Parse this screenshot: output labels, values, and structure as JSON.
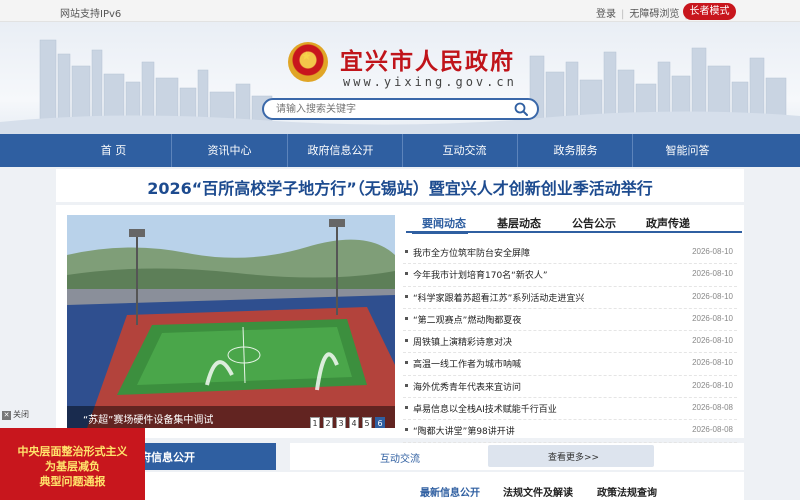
{
  "topbar": {
    "ipv6": "网站支持IPv6",
    "login": "登录",
    "accessible": "无障碍浏览",
    "elder_mode": "长者模式"
  },
  "header": {
    "title": "宜兴市人民政府",
    "url": "www.yixing.gov.cn",
    "emblem_icon": "national-emblem-icon"
  },
  "search": {
    "placeholder": "请输入搜索关键字",
    "icon": "search-icon"
  },
  "nav": {
    "items": [
      "首 页",
      "资讯中心",
      "政府信息公开",
      "互动交流",
      "政务服务",
      "智能问答"
    ]
  },
  "headline": "2026“百所高校学子地方行”（无锡站）暨宜兴人才创新创业季活动举行",
  "slideshow": {
    "caption": "“苏超”赛场硬件设备集中调试",
    "pages": [
      "1",
      "2",
      "3",
      "4",
      "5",
      "6"
    ],
    "active_page": 6
  },
  "news_tabs": [
    "要闻动态",
    "基层动态",
    "公告公示",
    "政声传递"
  ],
  "news": [
    {
      "title": "我市全方位筑牢防台安全屏障",
      "date": "2026-08-10"
    },
    {
      "title": "今年我市计划培育170名“新农人”",
      "date": "2026-08-10"
    },
    {
      "title": "“科学家跟着苏超看江苏”系列活动走进宜兴",
      "date": "2026-08-10"
    },
    {
      "title": "“第二观赛点”燃动陶都夏夜",
      "date": "2026-08-10"
    },
    {
      "title": "周铁镇上演精彩诗意对决",
      "date": "2026-08-10"
    },
    {
      "title": "高温一线工作者为城市呐喊",
      "date": "2026-08-10"
    },
    {
      "title": "海外优秀青年代表来宜访问",
      "date": "2026-08-10"
    },
    {
      "title": "卓易信息以全栈AI技术赋能千行百业",
      "date": "2026-08-08"
    },
    {
      "title": "“陶都大讲堂”第98讲开讲",
      "date": "2026-08-08"
    }
  ],
  "lower": {
    "tab1": "府信息公开",
    "tab2": "互动交流",
    "more": "查看更多>>",
    "subtabs": [
      "最新信息公开",
      "法规文件及解读",
      "政策法规查询"
    ]
  },
  "float_ad": {
    "close": "关闭",
    "lines": [
      "中央层面整治形式主义",
      "为基层减负",
      "典型问题通报"
    ]
  },
  "colors": {
    "brand_blue": "#2f5fa1",
    "brand_red": "#c8161d"
  }
}
